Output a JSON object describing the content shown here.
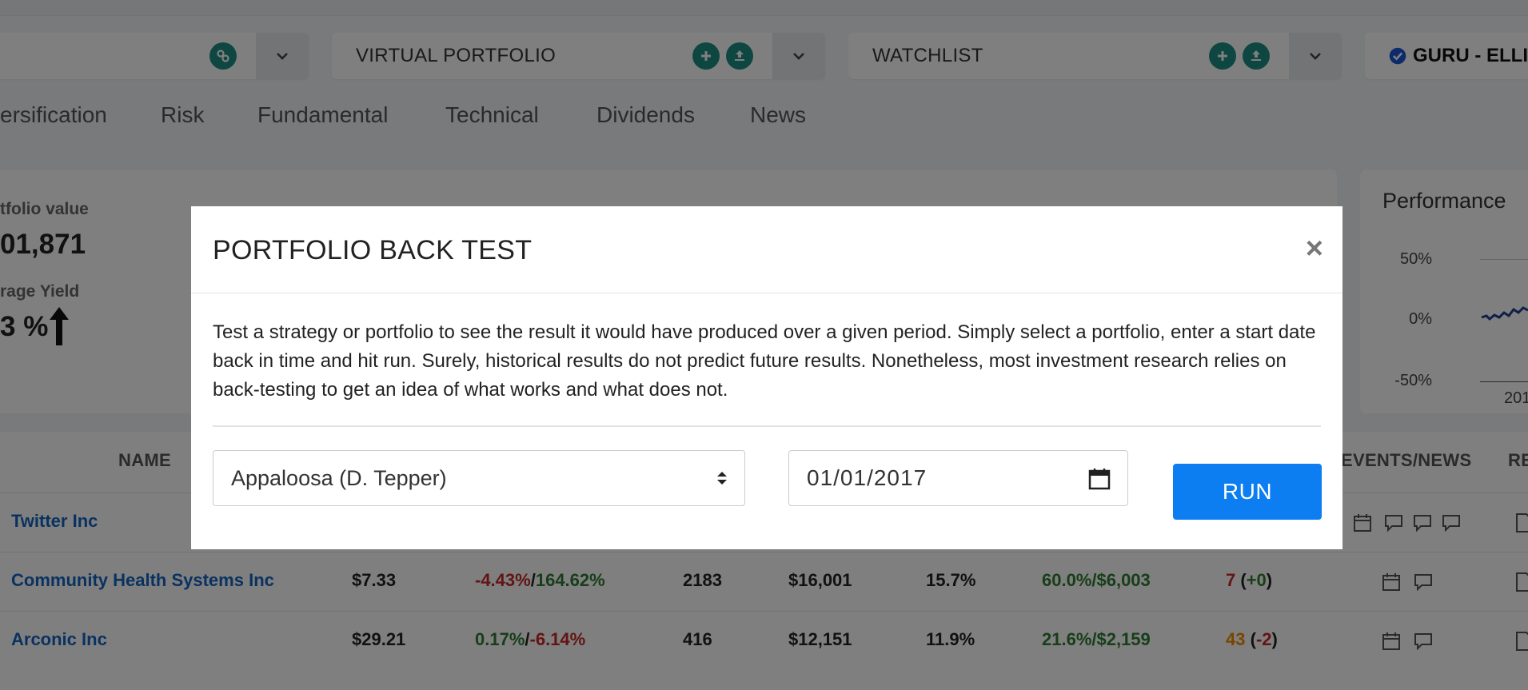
{
  "selectors": {
    "guru_partial": "",
    "virtual_portfolio": "VIRTUAL PORTFOLIO",
    "watchlist": "WATCHLIST",
    "guru_right": "GURU - ELLI"
  },
  "tabs": [
    "ersification",
    "Risk",
    "Fundamental",
    "Technical",
    "Dividends",
    "News"
  ],
  "stats": {
    "portfolio_value_label": "tfolio value",
    "portfolio_value": "01,871",
    "avg_yield_label": "rage Yield",
    "avg_yield": "3 %"
  },
  "performance": {
    "title": "Performance",
    "ticks": [
      "50%",
      "0%",
      "-50%"
    ],
    "year_partial": "201"
  },
  "table": {
    "headers": {
      "name": "NAME",
      "events": "EVENTS/NEWS",
      "re": "RE"
    },
    "rows": [
      {
        "name": "Twitter Inc",
        "price": "",
        "chg_a": "",
        "chg_b": "",
        "shares": "",
        "value": "",
        "pct": "",
        "gain": "",
        "score": "",
        "score_delta": ""
      },
      {
        "name": "Community Health Systems Inc",
        "price": "$7.33",
        "chg_a": "-4.43%",
        "chg_b": "164.62%",
        "shares": "2183",
        "value": "$16,001",
        "pct": "15.7%",
        "gain": "60.0%/$6,003",
        "score": "7",
        "score_delta": "+0"
      },
      {
        "name": "Arconic Inc",
        "price": "$29.21",
        "chg_a": "0.17%",
        "chg_b": "-6.14%",
        "shares": "416",
        "value": "$12,151",
        "pct": "11.9%",
        "gain": "21.6%/$2,159",
        "score": "43",
        "score_delta": "-2"
      }
    ]
  },
  "modal": {
    "title": "PORTFOLIO BACK TEST",
    "close": "×",
    "description": "Test a strategy or portfolio to see the result it would have produced over a given period. Simply select a portfolio, enter a start date back in time and hit run. Surely, historical results do not predict future results. Nonetheless, most investment research relies on back-testing to get an idea of what works and what does not.",
    "portfolio_selected": "Appaloosa (D. Tepper)",
    "start_date": "01/01/2017",
    "run_label": "RUN"
  },
  "colors": {
    "teal_button": "#1d8f82",
    "run_button": "#0d7ef2",
    "link": "#1565c0",
    "negative": "#c62828",
    "positive": "#2e7d32",
    "warning": "#ef8c00"
  }
}
